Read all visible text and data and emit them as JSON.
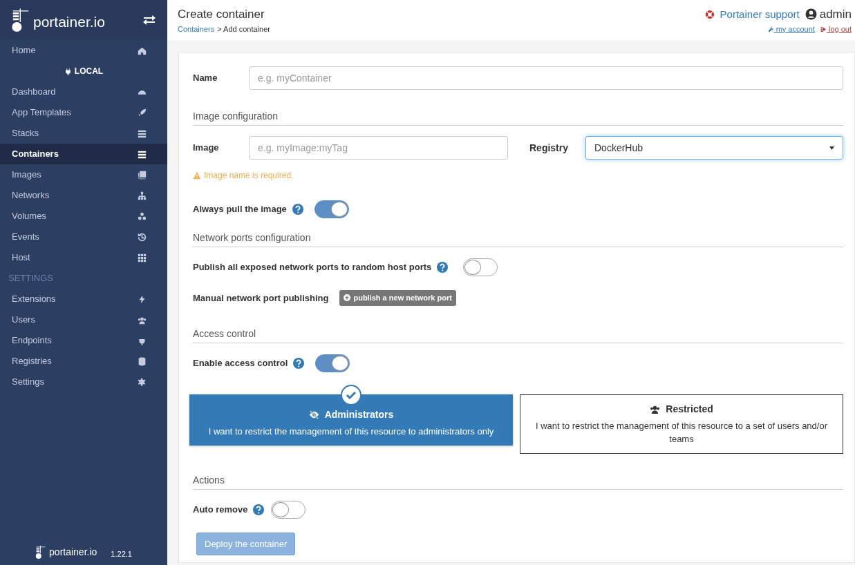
{
  "sidebar": {
    "brand": "portainer.io",
    "items": [
      {
        "label": "Home",
        "selected": false,
        "kind": "item"
      },
      {
        "label": "LOCAL",
        "kind": "endpoint"
      },
      {
        "label": "Dashboard",
        "selected": false,
        "kind": "item"
      },
      {
        "label": "App Templates",
        "selected": false,
        "kind": "item"
      },
      {
        "label": "Stacks",
        "selected": false,
        "kind": "item"
      },
      {
        "label": "Containers",
        "selected": true,
        "kind": "item"
      },
      {
        "label": "Images",
        "selected": false,
        "kind": "item"
      },
      {
        "label": "Networks",
        "selected": false,
        "kind": "item"
      },
      {
        "label": "Volumes",
        "selected": false,
        "kind": "item"
      },
      {
        "label": "Events",
        "selected": false,
        "kind": "item"
      },
      {
        "label": "Host",
        "selected": false,
        "kind": "item"
      },
      {
        "label": "SETTINGS",
        "kind": "heading"
      },
      {
        "label": "Extensions",
        "selected": false,
        "kind": "item"
      },
      {
        "label": "Users",
        "selected": false,
        "kind": "item"
      },
      {
        "label": "Endpoints",
        "selected": false,
        "kind": "item"
      },
      {
        "label": "Registries",
        "selected": false,
        "kind": "item"
      },
      {
        "label": "Settings",
        "selected": false,
        "kind": "item"
      }
    ],
    "footer_brand": "portainer.io",
    "version": "1.22.1"
  },
  "header": {
    "title": "Create container",
    "breadcrumb_link": "Containers",
    "breadcrumb_rest": "> Add container",
    "support": "Portainer support",
    "user": "admin",
    "my_account": "my account",
    "log_out": "log out"
  },
  "form": {
    "name": {
      "label": "Name",
      "placeholder": "e.g. myContainer"
    },
    "image_section": "Image configuration",
    "image": {
      "label": "Image",
      "placeholder": "e.g. myImage:myTag"
    },
    "registry": {
      "label": "Registry",
      "value": "DockerHub"
    },
    "image_warning": "Image name is required.",
    "always_pull": {
      "label": "Always pull the image",
      "on": true
    },
    "ports_section": "Network ports configuration",
    "publish_all": {
      "label": "Publish all exposed network ports to random host ports",
      "on": false
    },
    "manual_ports": {
      "label": "Manual network port publishing",
      "button": "publish a new network port"
    },
    "access_section": "Access control",
    "access_control": {
      "label": "Enable access control",
      "on": true
    },
    "access_options": [
      {
        "title": "Administrators",
        "description": "I want to restrict the management of this resource to administrators only",
        "selected": true
      },
      {
        "title": "Restricted",
        "description": "I want to restrict the management of this resource to a set of users and/or teams",
        "selected": false
      }
    ],
    "actions_section": "Actions",
    "auto_remove": {
      "label": "Auto remove",
      "on": false
    },
    "deploy_button": {
      "label": "Deploy the container",
      "disabled": true
    }
  }
}
